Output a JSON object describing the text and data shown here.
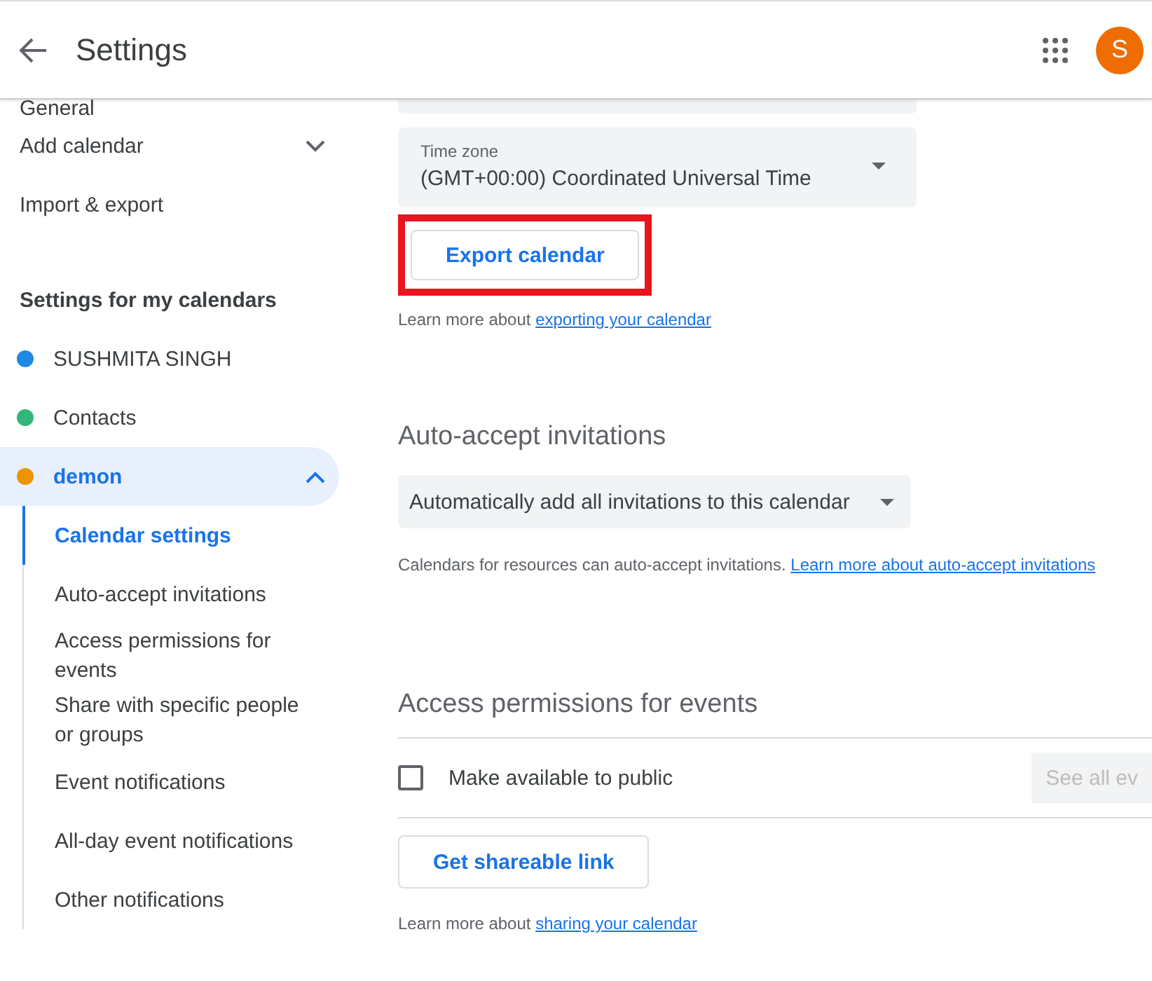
{
  "header": {
    "title": "Settings",
    "avatar": "S"
  },
  "sidebar": {
    "items": [
      {
        "label": "General",
        "kind": "cut"
      },
      {
        "label": "Add calendar",
        "kind": "expandable",
        "expanded": false
      },
      {
        "label": "Import & export",
        "kind": "plain"
      }
    ],
    "section_title": "Settings for my calendars",
    "calendars": [
      {
        "name": "SUSHMITA SINGH",
        "color": "#1e88e5",
        "selected": false,
        "expanded": false
      },
      {
        "name": "Contacts",
        "color": "#33b679",
        "selected": false,
        "expanded": false
      },
      {
        "name": "demon",
        "color": "#f09300",
        "selected": true,
        "expanded": true
      }
    ],
    "subitems": [
      {
        "label": "Calendar settings",
        "selected": true
      },
      {
        "label": "Auto-accept invitations",
        "selected": false
      },
      {
        "label": "Access permissions for events",
        "selected": false
      },
      {
        "label": "Share with specific people or groups",
        "selected": false
      },
      {
        "label": "Event notifications",
        "selected": false
      },
      {
        "label": "All-day event notifications",
        "selected": false
      },
      {
        "label": "Other notifications",
        "selected": false
      }
    ]
  },
  "main": {
    "time_zone": {
      "label": "Time zone",
      "value": "(GMT+00:00) Coordinated Universal Time"
    },
    "export_button": {
      "label": "Export calendar",
      "highlighted": true
    },
    "export_help": {
      "text": "Learn more about ",
      "link": "exporting your calendar"
    },
    "auto_accept": {
      "title": "Auto-accept invitations",
      "value": "Automatically add all invitations to this calendar",
      "help": "Calendars for resources can auto-accept invitations. ",
      "link": "Learn more about auto-accept invitations"
    },
    "access": {
      "title": "Access permissions for events",
      "checkbox": {
        "label": "Make available to public",
        "checked": false
      },
      "see_all_button": "See all ev",
      "share_button": "Get shareable link",
      "help": "Learn more about ",
      "link": "sharing your calendar"
    }
  }
}
